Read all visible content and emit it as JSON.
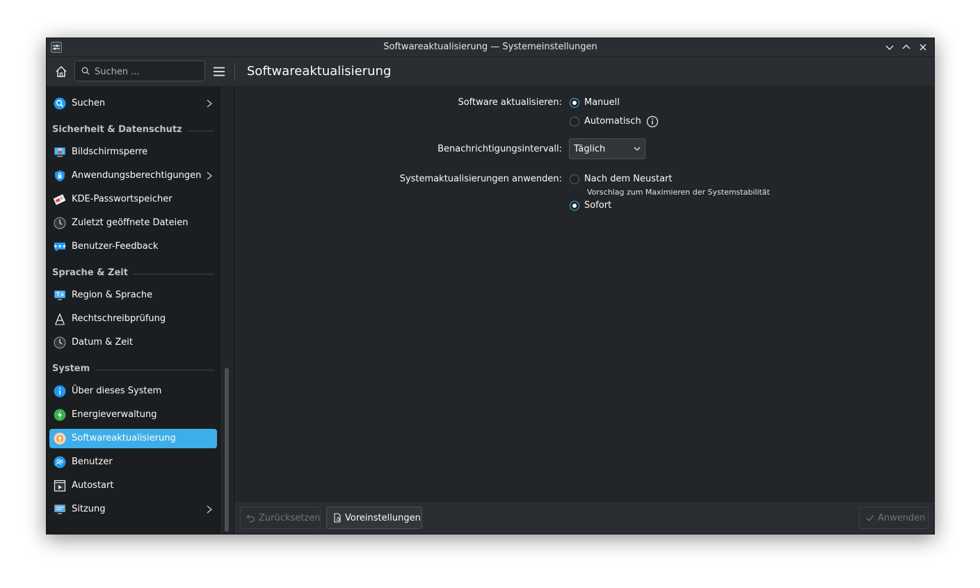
{
  "window": {
    "title": "Softwareaktualisierung — Systemeinstellungen"
  },
  "toolbar": {
    "search_placeholder": "Suchen ...",
    "page_title": "Softwareaktualisierung"
  },
  "sidebar": {
    "search_item": "Suchen",
    "sections": {
      "security": "Sicherheit & Datenschutz",
      "language": "Sprache & Zeit",
      "system": "System"
    },
    "items": {
      "screenlock": "Bildschirmsperre",
      "permissions": "Anwendungsberechtigungen",
      "kwallet": "KDE-Passwortspeicher",
      "recent": "Zuletzt geöffnete Dateien",
      "feedback": "Benutzer-Feedback",
      "region": "Region & Sprache",
      "spell": "Rechtschreibprüfung",
      "datetime": "Datum & Zeit",
      "about": "Über dieses System",
      "power": "Energieverwaltung",
      "updates": "Softwareaktualisierung",
      "users": "Benutzer",
      "autostart": "Autostart",
      "session": "Sitzung"
    },
    "selected": "updates",
    "accent_color": "#3daee9"
  },
  "form": {
    "update_label": "Software aktualisieren:",
    "update_manual": "Manuell",
    "update_auto": "Automatisch",
    "update_selected": "Manuell",
    "interval_label": "Benachrichtigungsintervall:",
    "interval_value": "Täglich",
    "apply_label": "Systemaktualisierungen anwenden:",
    "apply_after_restart": "Nach dem Neustart",
    "apply_hint": "Vorschlag zum Maximieren der Systemstabilität",
    "apply_now": "Sofort",
    "apply_selected": "Sofort"
  },
  "footer": {
    "reset": "Zurücksetzen",
    "defaults": "Voreinstellungen",
    "apply": "Anwenden"
  }
}
